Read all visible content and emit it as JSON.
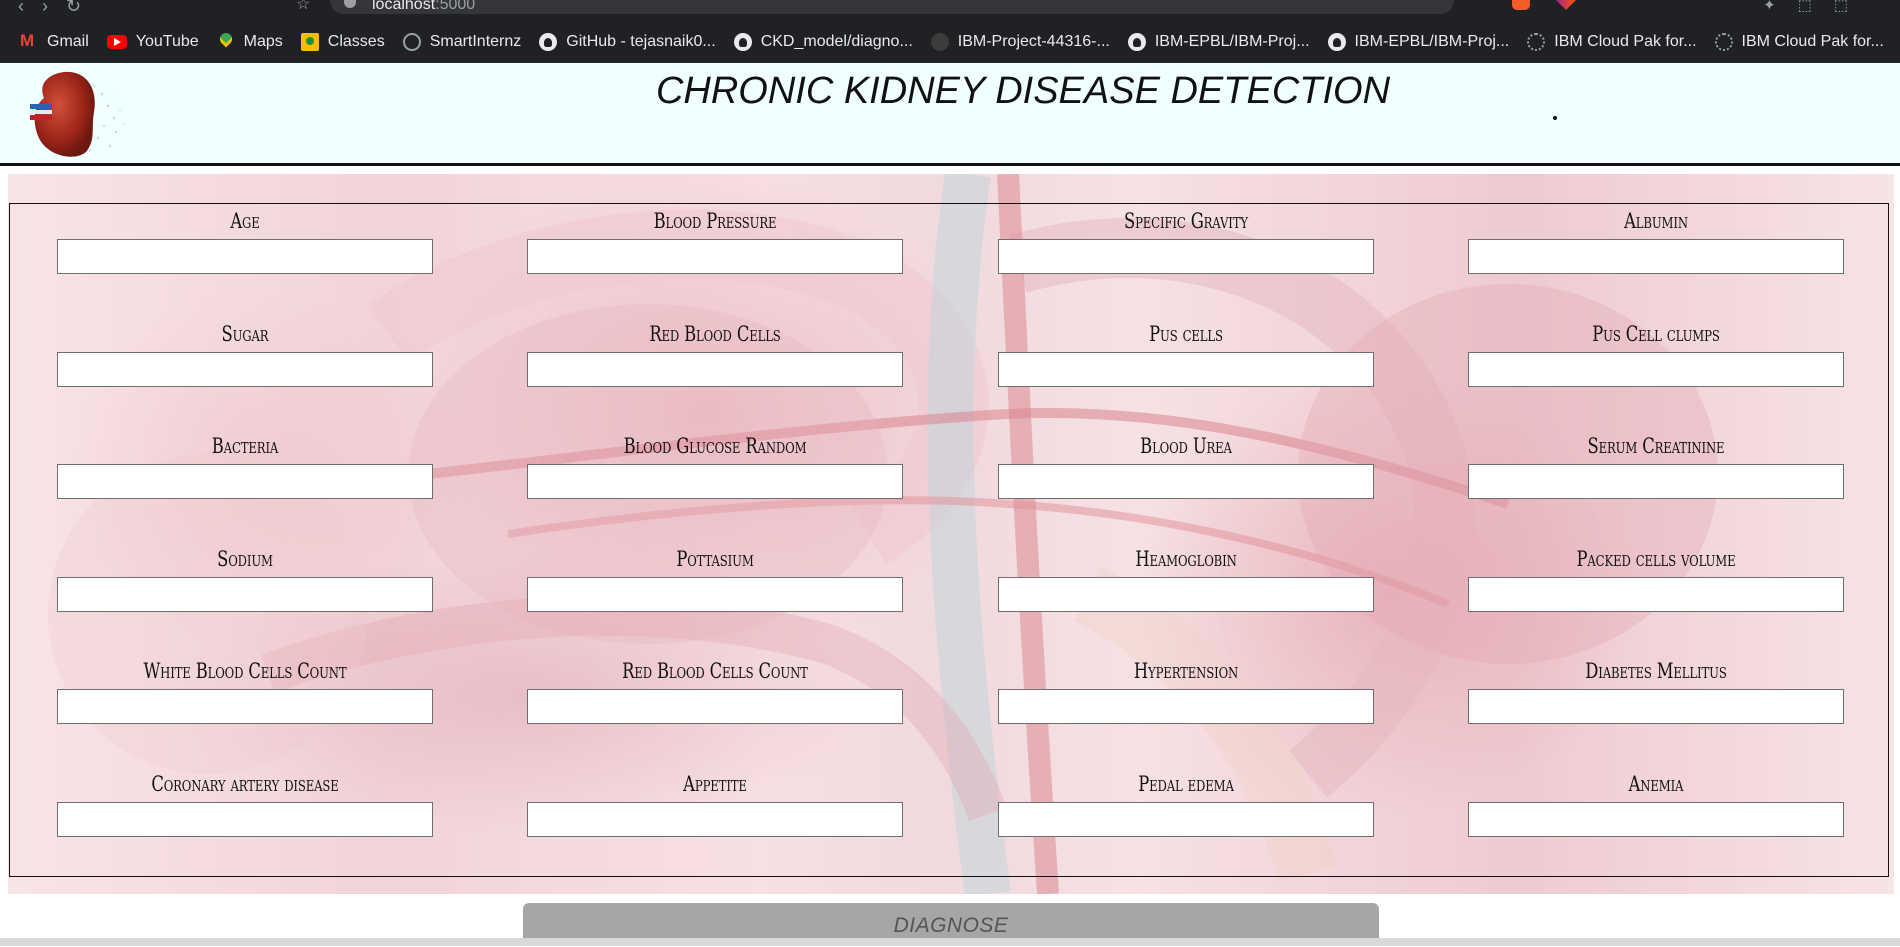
{
  "browser": {
    "url_host": "localhost",
    "url_port": ":5000",
    "bookmarks": [
      {
        "label": "Gmail",
        "icon": "gmail-icon"
      },
      {
        "label": "YouTube",
        "icon": "youtube-icon"
      },
      {
        "label": "Maps",
        "icon": "maps-icon"
      },
      {
        "label": "Classes",
        "icon": "classes-icon"
      },
      {
        "label": "SmartInternz",
        "icon": "globe-icon"
      },
      {
        "label": "GitHub - tejasnaik0...",
        "icon": "github-icon"
      },
      {
        "label": "CKD_model/diagno...",
        "icon": "github-icon"
      },
      {
        "label": "IBM-Project-44316-...",
        "icon": "github-icon"
      },
      {
        "label": "IBM-EPBL/IBM-Proj...",
        "icon": "github-icon"
      },
      {
        "label": "IBM-EPBL/IBM-Proj...",
        "icon": "github-icon"
      },
      {
        "label": "IBM Cloud Pak for...",
        "icon": "ibm-icon"
      },
      {
        "label": "IBM Cloud Pak for...",
        "icon": "ibm-icon"
      }
    ]
  },
  "header": {
    "title": "CHRONIC KIDNEY DISEASE DETECTION",
    "logo": "kidney-logo"
  },
  "form": {
    "fields": [
      {
        "label": "Age",
        "value": ""
      },
      {
        "label": "Blood Pressure",
        "value": ""
      },
      {
        "label": "Specific Gravity",
        "value": ""
      },
      {
        "label": "Albumin",
        "value": ""
      },
      {
        "label": "Sugar",
        "value": ""
      },
      {
        "label": "Red Blood Cells",
        "value": ""
      },
      {
        "label": "Pus cells",
        "value": ""
      },
      {
        "label": "Pus Cell clumps",
        "value": ""
      },
      {
        "label": "Bacteria",
        "value": ""
      },
      {
        "label": "Blood Glucose Random",
        "value": ""
      },
      {
        "label": "Blood Urea",
        "value": ""
      },
      {
        "label": "Serum Creatinine",
        "value": ""
      },
      {
        "label": "Sodium",
        "value": ""
      },
      {
        "label": "Pottasium",
        "value": ""
      },
      {
        "label": "Heamoglobin",
        "value": ""
      },
      {
        "label": "Packed cells volume",
        "value": ""
      },
      {
        "label": "White Blood Cells Count",
        "value": ""
      },
      {
        "label": "Red Blood Cells Count",
        "value": ""
      },
      {
        "label": "Hypertension",
        "value": ""
      },
      {
        "label": "Diabetes Mellitus",
        "value": ""
      },
      {
        "label": "Coronary artery disease",
        "value": ""
      },
      {
        "label": "Appetite",
        "value": ""
      },
      {
        "label": "Pedal edema",
        "value": ""
      },
      {
        "label": "Anemia",
        "value": ""
      }
    ],
    "submit_label": "DIAGNOSE"
  }
}
